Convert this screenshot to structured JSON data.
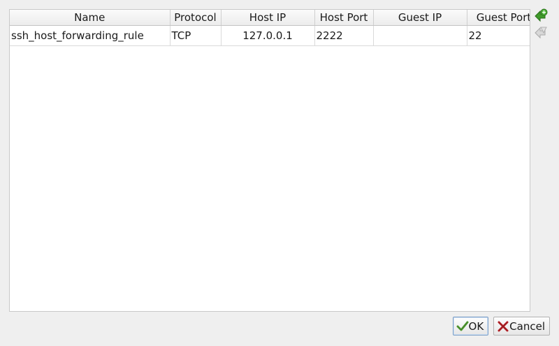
{
  "table": {
    "columns": [
      "Name",
      "Protocol",
      "Host IP",
      "Host Port",
      "Guest IP",
      "Guest Port"
    ],
    "rows": [
      {
        "name": "ssh_host_forwarding_rule",
        "protocol": "TCP",
        "host_ip": "127.0.0.1",
        "host_port": "2222",
        "guest_ip": "",
        "guest_port": "22"
      }
    ]
  },
  "side_tools": {
    "add_icon": "add-rule-icon",
    "remove_icon": "remove-rule-icon"
  },
  "buttons": {
    "ok_label": "OK",
    "cancel_label": "Cancel"
  },
  "colors": {
    "add_green": "#3f9a2a",
    "ok_green": "#5aa23a",
    "cancel_red": "#c0262c"
  }
}
